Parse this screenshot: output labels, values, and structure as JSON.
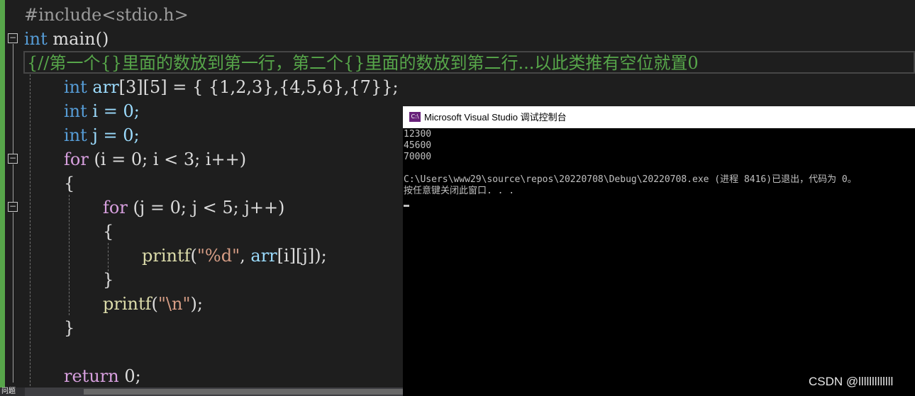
{
  "editor": {
    "lines": {
      "l1": "#include<stdio.h>",
      "l2_kw": "int",
      "l2_rest": " main()",
      "l3": "{//第一个{}里面的数放到第一行，第二个{}里面的数放到第二行...以此类推有空位就置0",
      "l4_kw": "int",
      "l4_var": " arr",
      "l4_rest": "[3][5] = { {1,2,3},{4,5,6},{7}};",
      "l5_kw": "int",
      "l5_rest": " i = 0;",
      "l6_kw": "int",
      "l6_rest": " j = 0;",
      "l7_kw": "for",
      "l7_rest": " (i = 0; i < 3; i++)",
      "l8": "{",
      "l9_kw": "for",
      "l9_rest": " (j = 0; j < 5; j++)",
      "l10": "{",
      "l11_fn": "printf",
      "l11_a": "(",
      "l11_str": "\"%d\"",
      "l11_b": ", ",
      "l11_var": "arr",
      "l11_c": "[i][j]);",
      "l12": "}",
      "l13_fn": "printf",
      "l13_a": "(",
      "l13_str": "\"\\n\"",
      "l13_b": ");",
      "l14": "}",
      "l15_kw": "return",
      "l15_rest": " 0;"
    },
    "bottom_tab": "问题"
  },
  "console": {
    "title": "Microsoft Visual Studio 调试控制台",
    "icon_text": "C:\\",
    "output": [
      "12300",
      "45600",
      "70000",
      "",
      "C:\\Users\\www29\\source\\repos\\20220708\\Debug\\20220708.exe (进程 8416)已退出，代码为 0。",
      "按任意键关闭此窗口. . ."
    ]
  },
  "watermark": "CSDN @lllllllllllll",
  "colors": {
    "keyword": "#569cd6",
    "control_keyword": "#d8a0df",
    "comment": "#57a64a",
    "console_bg": "#000000"
  }
}
